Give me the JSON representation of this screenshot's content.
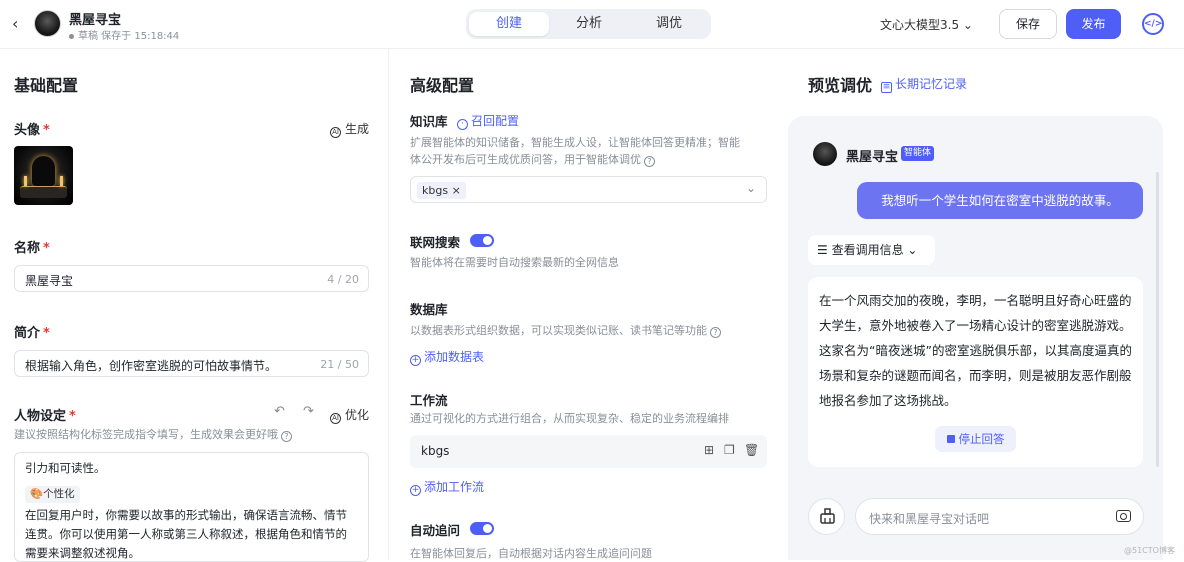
{
  "header": {
    "back_icon": "‹",
    "app_name": "黑屋寻宝",
    "draft_status": "草稿 保存于 15:18:44",
    "tabs": [
      {
        "label": "创建",
        "active": true
      },
      {
        "label": "分析",
        "active": false
      },
      {
        "label": "调优",
        "active": false
      }
    ],
    "model": "文心大模型3.5 ⌄",
    "save_label": "保存",
    "publish_label": "发布",
    "code_icon": "</>"
  },
  "basic": {
    "title": "基础配置",
    "avatar_label": "头像",
    "generate_label": "生成",
    "name_label": "名称",
    "name_value": "黑屋寻宝",
    "name_count": "4 / 20",
    "intro_label": "简介",
    "intro_value": "根据输入角色，创作密室逃脱的可怕故事情节。",
    "intro_count": "21 / 50",
    "persona_label": "人物设定",
    "optimize_label": "优化",
    "persona_hint": "建议按照结构化标签完成指令填写，生成效果会更好哦",
    "persona_line1": "引力和可读性。",
    "persona_tag": "🎨个性化",
    "persona_line2": "在回复用户时，你需要以故事的形式输出，确保语言流畅、情节",
    "persona_line3": "连贯。你可以使用第一人称或第三人称叙述，根据角色和情节的",
    "persona_line4": "需要来调整叙述视角。"
  },
  "advanced": {
    "title": "高级配置",
    "kb_label": "知识库",
    "recall_label": "召回配置",
    "kb_desc1": "扩展智能体的知识储备，智能生成人设，让智能体回答更精准；智能",
    "kb_desc2": "体公开发布后可生成优质问答，用于智能体调优",
    "kb_chip": "kbgs ×",
    "web_label": "联网搜索",
    "web_desc": "智能体将在需要时自动搜索最新的全网信息",
    "db_label": "数据库",
    "db_desc": "以数据表形式组织数据，可以实现类似记账、读书笔记等功能",
    "db_add": "添加数据表",
    "wf_label": "工作流",
    "wf_desc": "通过可视化的方式进行组合，从而实现复杂、稳定的业务流程编排",
    "wf_item": "kbgs",
    "wf_add": "添加工作流",
    "followup_label": "自动追问",
    "followup_desc": "在智能体回复后，自动根据对话内容生成追问问题"
  },
  "preview": {
    "title": "预览调优",
    "memory_label": "长期记忆记录",
    "bot_name": "黑屋寻宝",
    "bot_badge": "智能体",
    "user_message": "我想听一个学生如何在密室中逃脱的故事。",
    "invoke_label": "查看调用信息",
    "answer": "在一个风雨交加的夜晚，李明，一名聪明且好奇心旺盛的大学生，意外地被卷入了一场精心设计的密室逃脱游戏。这家名为“暗夜迷城”的密室逃脱俱乐部，以其高度逼真的场景和复杂的谜题而闻名，而李明，则是被朋友恶作剧般地报名参加了这场挑战。",
    "stop_label": "停止回答",
    "input_placeholder": "快来和黑屋寻宝对话吧"
  },
  "watermark": "@51CTO博客",
  "colors": {
    "accent": "#4e5ef7",
    "user_bubble": "#6d74f2",
    "required": "#e53935"
  }
}
